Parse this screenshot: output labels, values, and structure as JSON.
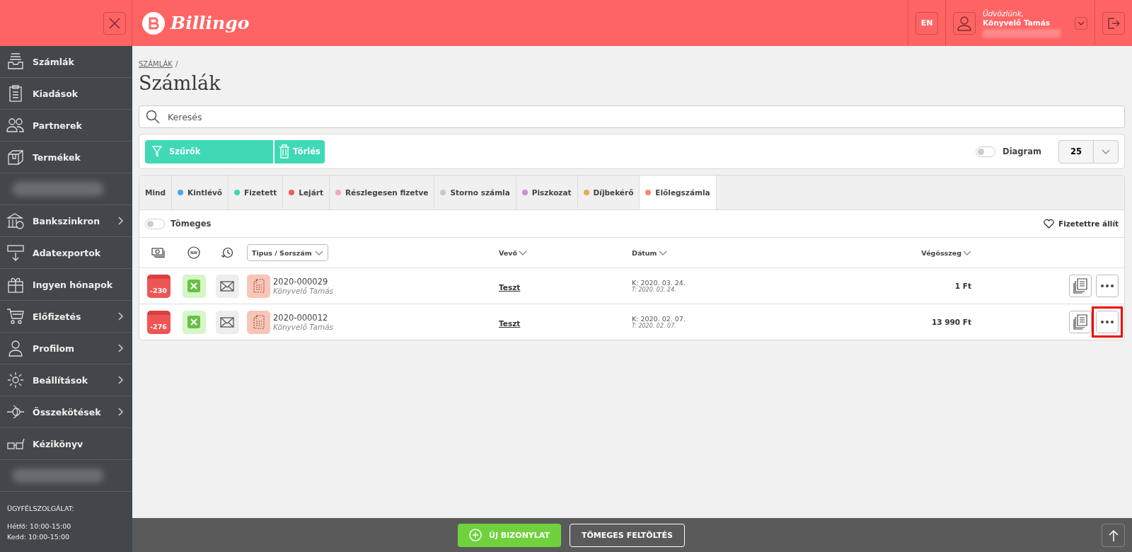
{
  "header": {
    "logo": "Billingo",
    "language": "EN",
    "greeting": "Üdvözlünk,",
    "user_name": "Könyvelő Tamás"
  },
  "sidebar": {
    "items": [
      {
        "kind": "item",
        "label": "Számlák",
        "has_submenu": false
      },
      {
        "kind": "item",
        "label": "Kiadások",
        "has_submenu": false
      },
      {
        "kind": "item",
        "label": "Partnerek",
        "has_submenu": false
      },
      {
        "kind": "item",
        "label": "Termékek",
        "has_submenu": false
      },
      {
        "kind": "redacted"
      },
      {
        "kind": "item",
        "label": "Bankszinkron",
        "has_submenu": true
      },
      {
        "kind": "item",
        "label": "Adatexportok",
        "has_submenu": false
      },
      {
        "kind": "item",
        "label": "Ingyen hónapok",
        "has_submenu": false
      },
      {
        "kind": "item",
        "label": "Előfizetés",
        "has_submenu": true
      },
      {
        "kind": "item",
        "label": "Profilom",
        "has_submenu": true
      },
      {
        "kind": "item",
        "label": "Beállítások",
        "has_submenu": true
      },
      {
        "kind": "item",
        "label": "Összekötések",
        "has_submenu": true
      },
      {
        "kind": "item",
        "label": "Kézikönyv",
        "has_submenu": false
      },
      {
        "kind": "redacted"
      }
    ],
    "support": {
      "title": "ÜGYFÉLSZOLGÁLAT:",
      "hours": [
        "Hétfő: 10:00-15:00",
        "Kedd: 10:00-15:00"
      ]
    }
  },
  "breadcrumb": "SZÁMLÁK",
  "breadcrumb_separator": "/",
  "page_title": "Számlák",
  "search": {
    "placeholder": "Keresés"
  },
  "toolbar": {
    "filters_button": "Szűrők",
    "clear_button": "Törlés",
    "diagram_toggle": {
      "label": "Diagram",
      "on": false
    },
    "page_size": "25"
  },
  "tabs": [
    {
      "label": "Mind",
      "selected": false
    },
    {
      "label": "Kintlévő",
      "color": "#4aa8e8",
      "selected": false
    },
    {
      "label": "Fizetett",
      "color": "#3dd6b5",
      "selected": false
    },
    {
      "label": "Lejárt",
      "color": "#f25c5c",
      "selected": false
    },
    {
      "label": "Részlegesen fizetve",
      "color": "#f5a3c7",
      "selected": false
    },
    {
      "label": "Storno számla",
      "color": "#c8c8c8",
      "selected": false
    },
    {
      "label": "Piszkozat",
      "color": "#c98fd1",
      "selected": false
    },
    {
      "label": "Díjbekérő",
      "color": "#e8aa55",
      "selected": false
    },
    {
      "label": "Előlegszámla",
      "color": "#f28c6f",
      "selected": true
    }
  ],
  "bulk_toggle": {
    "label": "Tömeges",
    "on": false
  },
  "mark_paid": "Fizetettre állít",
  "table": {
    "columns": {
      "type": "Tipus / Sorszám",
      "buyer": "Vevő",
      "date": "Dátum",
      "total": "Végösszeg"
    },
    "rows": [
      {
        "overdue_days": "-230",
        "number": "2020-000029",
        "author": "Könyvelő Tamás",
        "buyer": "Teszt",
        "issued": "K: 2020. 03. 24.",
        "due": "T: 2020. 03. 24.",
        "total": "1 Ft",
        "more_highlighted": false
      },
      {
        "overdue_days": "-276",
        "number": "2020-000012",
        "author": "Könyvelő Tamás",
        "buyer": "Teszt",
        "issued": "K: 2020. 02. 07.",
        "due": "T: 2020. 02. 07.",
        "total": "13 990 Ft",
        "more_highlighted": true
      }
    ]
  },
  "footer": {
    "new_button": "ÚJ BIZONYLAT",
    "upload_button": "TÖMEGES FELTÖLTÉS"
  }
}
